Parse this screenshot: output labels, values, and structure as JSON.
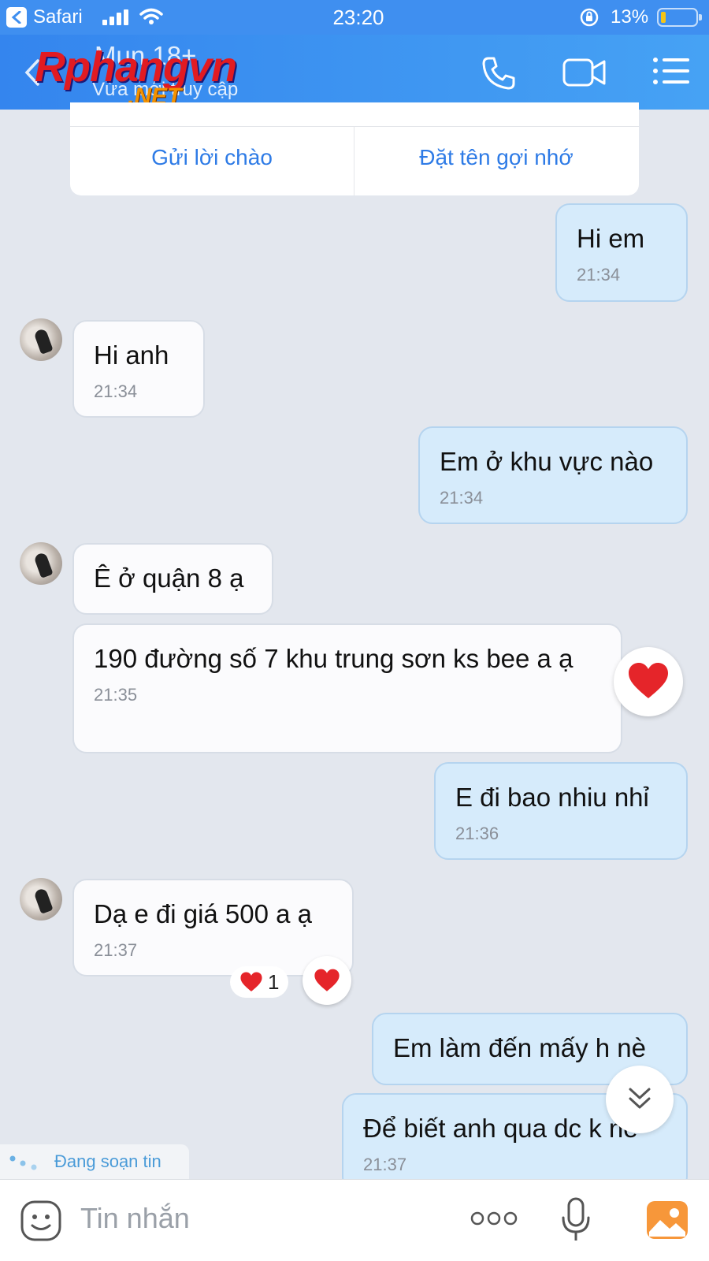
{
  "status_bar": {
    "back_app": "Safari",
    "time": "23:20",
    "battery": "13%",
    "battery_level": 0.13
  },
  "header": {
    "contact_name": "Mun 18+",
    "status": "Vừa mới truy cập",
    "watermark_main": "Rphangvn",
    "watermark_suffix": ".NET"
  },
  "suggestions": {
    "greet_label": "Gửi lời chào",
    "nickname_label": "Đặt tên gợi nhớ"
  },
  "messages": [
    {
      "side": "out",
      "text": "Hi em",
      "time": "21:34"
    },
    {
      "side": "in",
      "text": "Hi anh",
      "time": "21:34"
    },
    {
      "side": "out",
      "text": "Em ở khu vực nào",
      "time": "21:34"
    },
    {
      "side": "in",
      "text": "Ê ở quận 8 ạ",
      "time": ""
    },
    {
      "side": "in",
      "text": "190 đường số 7 khu trung sơn ks bee a ạ",
      "time": "21:35"
    },
    {
      "side": "out",
      "text": "E đi bao nhiu nhỉ",
      "time": "21:36"
    },
    {
      "side": "in",
      "text": "Dạ e đi giá 500 a ạ",
      "time": "21:37"
    },
    {
      "side": "out",
      "text": "Em làm đến mấy h nè",
      "time": ""
    },
    {
      "side": "out",
      "text": "Để biết anh qua dc k nè",
      "time": "21:37"
    }
  ],
  "reactions": {
    "heart_count": "1"
  },
  "typing_indicator": "Đang soạn tin",
  "composer": {
    "placeholder": "Tin nhắn"
  },
  "colors": {
    "header": "#3f8ff0",
    "outgoing_bubble": "#d6ebfb",
    "incoming_bubble": "#fbfbfd",
    "link": "#2e7be6",
    "heart": "#e5252a"
  },
  "icons": [
    "back-app-icon",
    "signal-icon",
    "wifi-icon",
    "rotation-lock-icon",
    "battery-icon",
    "back-chevron-icon",
    "phone-icon",
    "video-call-icon",
    "menu-list-icon",
    "heart-icon",
    "scroll-down-icon",
    "emoji-icon",
    "more-icon",
    "microphone-icon",
    "photo-icon"
  ]
}
